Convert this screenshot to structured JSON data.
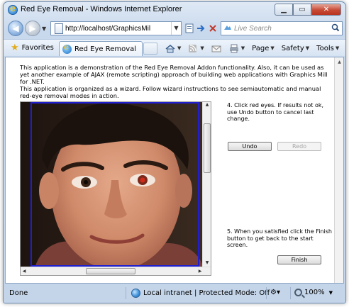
{
  "window": {
    "title": "Red Eye Removal - Windows Internet Explorer"
  },
  "address_bar": {
    "url": "http://localhost/GraphicsMil"
  },
  "search": {
    "placeholder": "Live Search"
  },
  "command_bar": {
    "favorites_label": "Favorites",
    "tab_label": "Red Eye Removal",
    "page_label": "Page",
    "safety_label": "Safety",
    "tools_label": "Tools"
  },
  "content": {
    "intro": "This application is a demonstration of the Red Eye Removal Addon functionality. Also, it can be used as yet another example of AJAX (remote scripting) approach of building web applications with Graphics Mill for .NET.",
    "wizard_note": "This application is organized as a wizard. Follow wizard instructions to see semiautomatic and manual red-eye removal modes in action.",
    "step4_text": "4. Click red eyes. If results not ok, use Undo button to cancel last change.",
    "undo_label": "Undo",
    "redo_label": "Redo",
    "step5_text": "5. When you satisfied click the Finish button to get back to the start screen.",
    "finish_label": "Finish"
  },
  "status_bar": {
    "status_text": "Done",
    "zone_text": "Local intranet | Protected Mode: Off",
    "zoom_text": "100%"
  }
}
